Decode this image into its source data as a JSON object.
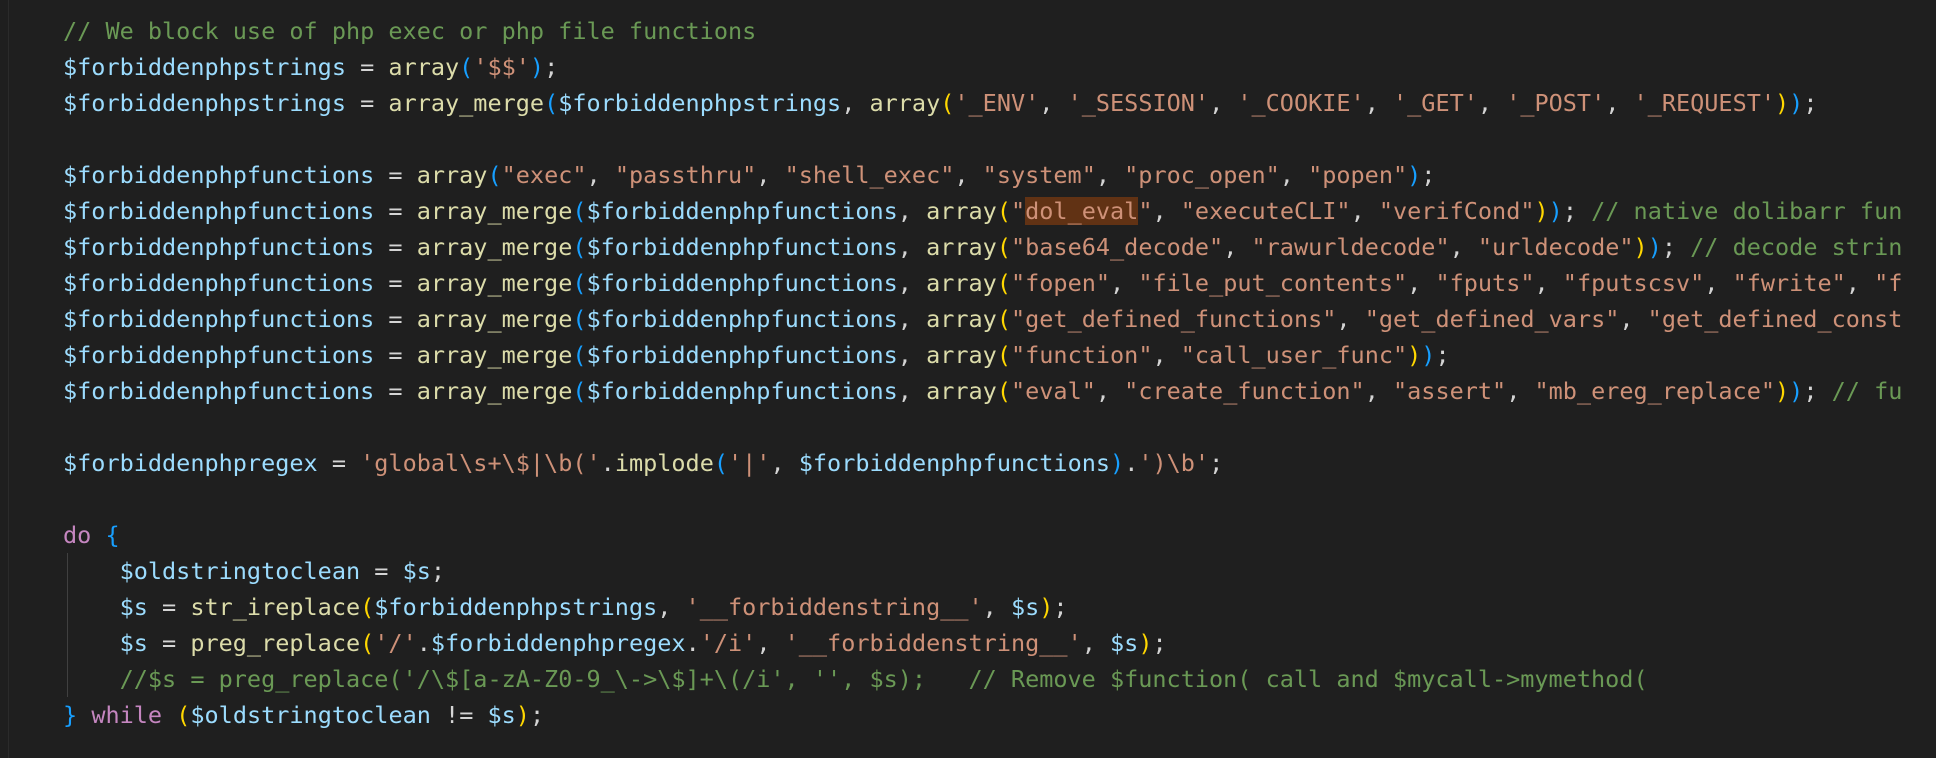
{
  "editor": {
    "language": "php",
    "highlight_word": "dol_eval"
  },
  "lines": [
    [
      [
        "c",
        "// We block use of php exec or php file functions"
      ]
    ],
    [
      [
        "v",
        "$forbiddenphpstrings"
      ],
      [
        "o",
        " = "
      ],
      [
        "f",
        "array"
      ],
      [
        "b3",
        "("
      ],
      [
        "s",
        "'$$'"
      ],
      [
        "b3",
        ")"
      ],
      [
        "o",
        ";"
      ]
    ],
    [
      [
        "v",
        "$forbiddenphpstrings"
      ],
      [
        "o",
        " = "
      ],
      [
        "f",
        "array_merge"
      ],
      [
        "b3",
        "("
      ],
      [
        "v",
        "$forbiddenphpstrings"
      ],
      [
        "o",
        ", "
      ],
      [
        "f",
        "array"
      ],
      [
        "b1",
        "("
      ],
      [
        "s",
        "'_ENV'"
      ],
      [
        "o",
        ", "
      ],
      [
        "s",
        "'_SESSION'"
      ],
      [
        "o",
        ", "
      ],
      [
        "s",
        "'_COOKIE'"
      ],
      [
        "o",
        ", "
      ],
      [
        "s",
        "'_GET'"
      ],
      [
        "o",
        ", "
      ],
      [
        "s",
        "'_POST'"
      ],
      [
        "o",
        ", "
      ],
      [
        "s",
        "'_REQUEST'"
      ],
      [
        "b1",
        ")"
      ],
      [
        "b3",
        ")"
      ],
      [
        "o",
        ";"
      ]
    ],
    [],
    [
      [
        "v",
        "$forbiddenphpfunctions"
      ],
      [
        "o",
        " = "
      ],
      [
        "f",
        "array"
      ],
      [
        "b3",
        "("
      ],
      [
        "s",
        "\"exec\""
      ],
      [
        "o",
        ", "
      ],
      [
        "s",
        "\"passthru\""
      ],
      [
        "o",
        ", "
      ],
      [
        "s",
        "\"shell_exec\""
      ],
      [
        "o",
        ", "
      ],
      [
        "s",
        "\"system\""
      ],
      [
        "o",
        ", "
      ],
      [
        "s",
        "\"proc_open\""
      ],
      [
        "o",
        ", "
      ],
      [
        "s",
        "\"popen\""
      ],
      [
        "b3",
        ")"
      ],
      [
        "o",
        ";"
      ]
    ],
    [
      [
        "v",
        "$forbiddenphpfunctions"
      ],
      [
        "o",
        " = "
      ],
      [
        "f",
        "array_merge"
      ],
      [
        "b3",
        "("
      ],
      [
        "v",
        "$forbiddenphpfunctions"
      ],
      [
        "o",
        ", "
      ],
      [
        "f",
        "array"
      ],
      [
        "b1",
        "("
      ],
      [
        "s",
        "\""
      ],
      [
        "h",
        "dol_eval"
      ],
      [
        "s",
        "\""
      ],
      [
        "o",
        ", "
      ],
      [
        "s",
        "\"executeCLI\""
      ],
      [
        "o",
        ", "
      ],
      [
        "s",
        "\"verifCond\""
      ],
      [
        "b1",
        ")"
      ],
      [
        "b3",
        ")"
      ],
      [
        "o",
        "; "
      ],
      [
        "c",
        "// native dolibarr fun"
      ]
    ],
    [
      [
        "v",
        "$forbiddenphpfunctions"
      ],
      [
        "o",
        " = "
      ],
      [
        "f",
        "array_merge"
      ],
      [
        "b3",
        "("
      ],
      [
        "v",
        "$forbiddenphpfunctions"
      ],
      [
        "o",
        ", "
      ],
      [
        "f",
        "array"
      ],
      [
        "b1",
        "("
      ],
      [
        "s",
        "\"base64_decode\""
      ],
      [
        "o",
        ", "
      ],
      [
        "s",
        "\"rawurldecode\""
      ],
      [
        "o",
        ", "
      ],
      [
        "s",
        "\"urldecode\""
      ],
      [
        "b1",
        ")"
      ],
      [
        "b3",
        ")"
      ],
      [
        "o",
        "; "
      ],
      [
        "c",
        "// decode strin"
      ]
    ],
    [
      [
        "v",
        "$forbiddenphpfunctions"
      ],
      [
        "o",
        " = "
      ],
      [
        "f",
        "array_merge"
      ],
      [
        "b3",
        "("
      ],
      [
        "v",
        "$forbiddenphpfunctions"
      ],
      [
        "o",
        ", "
      ],
      [
        "f",
        "array"
      ],
      [
        "b1",
        "("
      ],
      [
        "s",
        "\"fopen\""
      ],
      [
        "o",
        ", "
      ],
      [
        "s",
        "\"file_put_contents\""
      ],
      [
        "o",
        ", "
      ],
      [
        "s",
        "\"fputs\""
      ],
      [
        "o",
        ", "
      ],
      [
        "s",
        "\"fputscsv\""
      ],
      [
        "o",
        ", "
      ],
      [
        "s",
        "\"fwrite\""
      ],
      [
        "o",
        ", "
      ],
      [
        "s",
        "\"f"
      ]
    ],
    [
      [
        "v",
        "$forbiddenphpfunctions"
      ],
      [
        "o",
        " = "
      ],
      [
        "f",
        "array_merge"
      ],
      [
        "b3",
        "("
      ],
      [
        "v",
        "$forbiddenphpfunctions"
      ],
      [
        "o",
        ", "
      ],
      [
        "f",
        "array"
      ],
      [
        "b1",
        "("
      ],
      [
        "s",
        "\"get_defined_functions\""
      ],
      [
        "o",
        ", "
      ],
      [
        "s",
        "\"get_defined_vars\""
      ],
      [
        "o",
        ", "
      ],
      [
        "s",
        "\"get_defined_const"
      ]
    ],
    [
      [
        "v",
        "$forbiddenphpfunctions"
      ],
      [
        "o",
        " = "
      ],
      [
        "f",
        "array_merge"
      ],
      [
        "b3",
        "("
      ],
      [
        "v",
        "$forbiddenphpfunctions"
      ],
      [
        "o",
        ", "
      ],
      [
        "f",
        "array"
      ],
      [
        "b1",
        "("
      ],
      [
        "s",
        "\"function\""
      ],
      [
        "o",
        ", "
      ],
      [
        "s",
        "\"call_user_func\""
      ],
      [
        "b1",
        ")"
      ],
      [
        "b3",
        ")"
      ],
      [
        "o",
        ";"
      ]
    ],
    [
      [
        "v",
        "$forbiddenphpfunctions"
      ],
      [
        "o",
        " = "
      ],
      [
        "f",
        "array_merge"
      ],
      [
        "b3",
        "("
      ],
      [
        "v",
        "$forbiddenphpfunctions"
      ],
      [
        "o",
        ", "
      ],
      [
        "f",
        "array"
      ],
      [
        "b1",
        "("
      ],
      [
        "s",
        "\"eval\""
      ],
      [
        "o",
        ", "
      ],
      [
        "s",
        "\"create_function\""
      ],
      [
        "o",
        ", "
      ],
      [
        "s",
        "\"assert\""
      ],
      [
        "o",
        ", "
      ],
      [
        "s",
        "\"mb_ereg_replace\""
      ],
      [
        "b1",
        ")"
      ],
      [
        "b3",
        ")"
      ],
      [
        "o",
        "; "
      ],
      [
        "c",
        "// fu"
      ]
    ],
    [],
    [
      [
        "v",
        "$forbiddenphpregex"
      ],
      [
        "o",
        " = "
      ],
      [
        "s",
        "'global\\s+\\$|\\b('"
      ],
      [
        "o",
        "."
      ],
      [
        "f",
        "implode"
      ],
      [
        "b3",
        "("
      ],
      [
        "s",
        "'|'"
      ],
      [
        "o",
        ", "
      ],
      [
        "v",
        "$forbiddenphpfunctions"
      ],
      [
        "b3",
        ")"
      ],
      [
        "o",
        "."
      ],
      [
        "s",
        "')\\b'"
      ],
      [
        "o",
        ";"
      ]
    ],
    [],
    [
      [
        "k",
        "do"
      ],
      [
        "o",
        " "
      ],
      [
        "b3",
        "{"
      ]
    ],
    [
      [
        "o",
        "    "
      ],
      [
        "v",
        "$oldstringtoclean"
      ],
      [
        "o",
        " = "
      ],
      [
        "v",
        "$s"
      ],
      [
        "o",
        ";"
      ]
    ],
    [
      [
        "o",
        "    "
      ],
      [
        "v",
        "$s"
      ],
      [
        "o",
        " = "
      ],
      [
        "f",
        "str_ireplace"
      ],
      [
        "b1",
        "("
      ],
      [
        "v",
        "$forbiddenphpstrings"
      ],
      [
        "o",
        ", "
      ],
      [
        "s",
        "'__forbiddenstring__'"
      ],
      [
        "o",
        ", "
      ],
      [
        "v",
        "$s"
      ],
      [
        "b1",
        ")"
      ],
      [
        "o",
        ";"
      ]
    ],
    [
      [
        "o",
        "    "
      ],
      [
        "v",
        "$s"
      ],
      [
        "o",
        " = "
      ],
      [
        "f",
        "preg_replace"
      ],
      [
        "b1",
        "("
      ],
      [
        "s",
        "'/'"
      ],
      [
        "o",
        "."
      ],
      [
        "v",
        "$forbiddenphpregex"
      ],
      [
        "o",
        "."
      ],
      [
        "s",
        "'/i'"
      ],
      [
        "o",
        ", "
      ],
      [
        "s",
        "'__forbiddenstring__'"
      ],
      [
        "o",
        ", "
      ],
      [
        "v",
        "$s"
      ],
      [
        "b1",
        ")"
      ],
      [
        "o",
        ";"
      ]
    ],
    [
      [
        "o",
        "    "
      ],
      [
        "c",
        "//$s = preg_replace('/\\$[a-zA-Z0-9_\\->\\$]+\\(/i', '', $s);   // Remove $function( call and $mycall->mymethod("
      ]
    ],
    [
      [
        "b3",
        "}"
      ],
      [
        "o",
        " "
      ],
      [
        "k",
        "while"
      ],
      [
        "o",
        " "
      ],
      [
        "b1",
        "("
      ],
      [
        "v",
        "$oldstringtoclean"
      ],
      [
        "o",
        " != "
      ],
      [
        "v",
        "$s"
      ],
      [
        "b1",
        ")"
      ],
      [
        "o",
        ";"
      ]
    ]
  ]
}
